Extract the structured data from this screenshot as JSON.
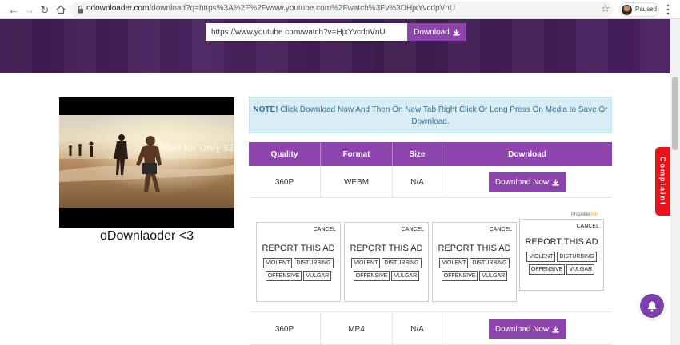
{
  "browser": {
    "url_host": "odownloader.com",
    "url_path": "/download?q=https%3A%2F%2Fwww.youtube.com%2Fwatch%3Fv%3DHjxYvcdpVnU",
    "profile_status": "Paused"
  },
  "hero": {
    "input_value": "https://www.youtube.com/watch?v=HjxYvcdpVnU",
    "download_label": "Download"
  },
  "video": {
    "thumb_overlay": "Start for Only $25",
    "title": "oDownlaoder <3"
  },
  "note": {
    "strong": "NOTE!",
    "text": " Click Download Now And Then On New Tab Right Click Or Long Press On Media to Save Or Download."
  },
  "table": {
    "headers": [
      "Quality",
      "Format",
      "Size",
      "Download"
    ],
    "rows": [
      {
        "quality": "360P",
        "format": "WEBM",
        "size": "N/A",
        "action": "Download Now"
      },
      {
        "quality": "360P",
        "format": "MP4",
        "size": "N/A",
        "action": "Download Now"
      }
    ]
  },
  "ads": {
    "provider_prefix": "Propeller",
    "provider_suffix": "Ads",
    "cancel": "CANCEL",
    "title": "REPORT THIS AD",
    "tags": [
      "VIOLENT",
      "DISTURBING",
      "OFFENSIVE",
      "VULGAR"
    ]
  },
  "complaint_label": "Complaint",
  "colors": {
    "brand_purple": "#8e44ad",
    "hero_dark": "#3c1a4e",
    "note_bg": "#d9edf7",
    "complaint_red": "#e8141b"
  }
}
